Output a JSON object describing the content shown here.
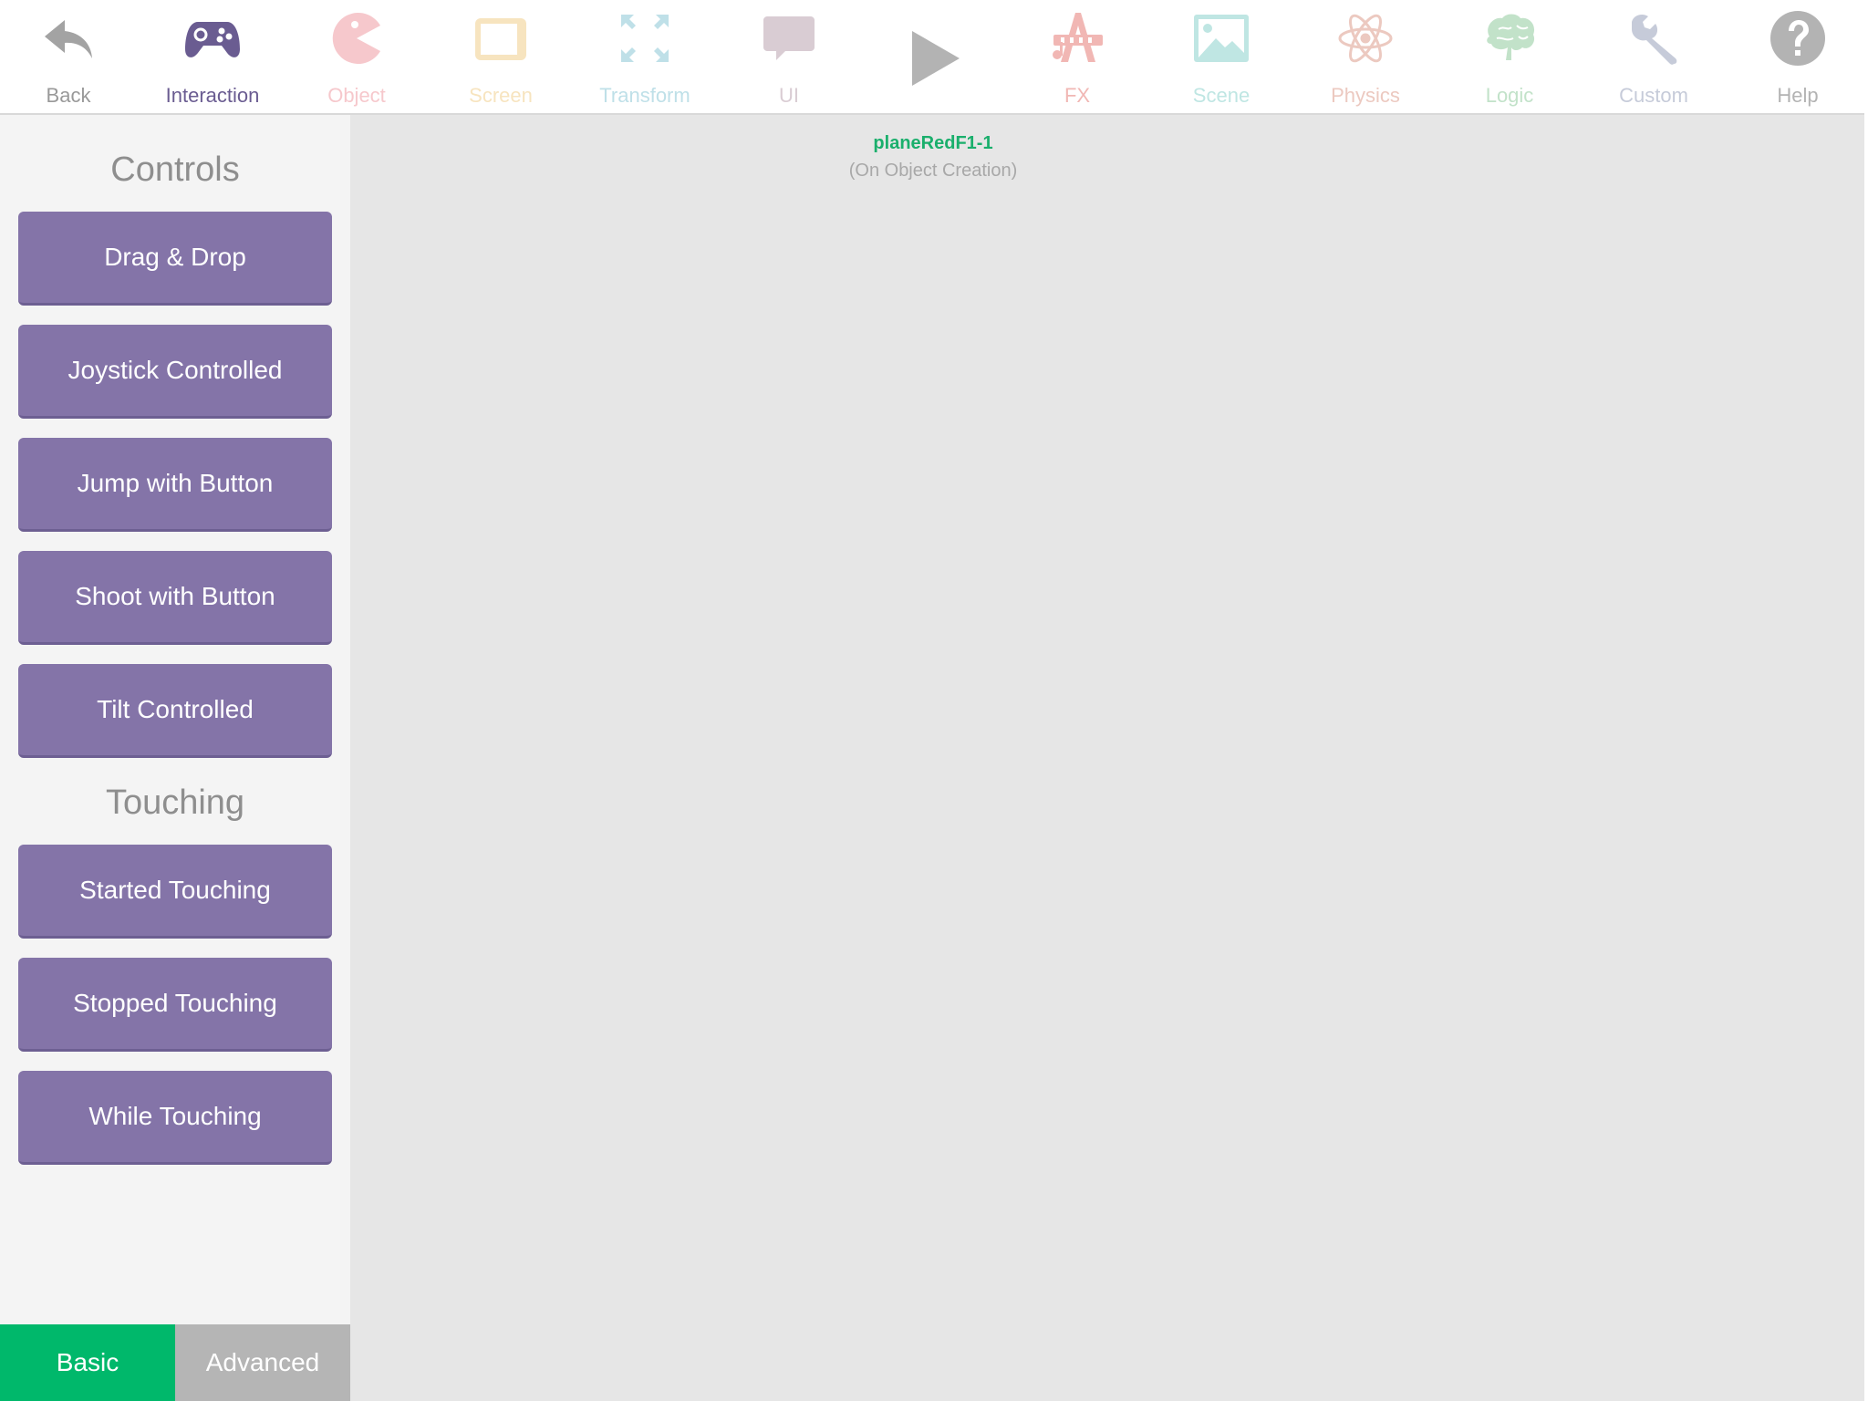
{
  "toolbar": {
    "back": {
      "label": "Back",
      "color": "#999999",
      "icon": "back-arrow-icon"
    },
    "interaction": {
      "label": "Interaction",
      "color": "#6a5c91",
      "icon": "gamepad-icon"
    },
    "object": {
      "label": "Object",
      "color": "#f6c8cc",
      "icon": "pacman-icon"
    },
    "screen": {
      "label": "Screen",
      "color": "#f7e4bf",
      "icon": "tablet-screen-icon"
    },
    "transform": {
      "label": "Transform",
      "color": "#bfe0e8",
      "icon": "transform-arrows-icon"
    },
    "ui": {
      "label": "UI",
      "color": "#d9ccd3",
      "icon": "speech-bubble-icon"
    },
    "play": {
      "icon": "play-icon",
      "color": "#b3b3b3"
    },
    "fx": {
      "label": "FX",
      "color": "#f1b7b4",
      "icon": "fx-music-icon"
    },
    "scene": {
      "label": "Scene",
      "color": "#bfe6e3",
      "icon": "scene-image-icon"
    },
    "physics": {
      "label": "Physics",
      "color": "#ecc9c0",
      "icon": "atom-icon"
    },
    "logic": {
      "label": "Logic",
      "color": "#c2e2c9",
      "icon": "brain-icon"
    },
    "custom": {
      "label": "Custom",
      "color": "#c6cbd9",
      "icon": "wrench-icon"
    },
    "help": {
      "label": "Help",
      "color": "#b3b3b3",
      "icon": "question-icon"
    }
  },
  "sidebar": {
    "controls_title": "Controls",
    "controls": [
      {
        "label": "Drag & Drop"
      },
      {
        "label": "Joystick Controlled"
      },
      {
        "label": "Jump with Button"
      },
      {
        "label": "Shoot with Button"
      },
      {
        "label": "Tilt Controlled"
      }
    ],
    "touching_title": "Touching",
    "touching": [
      {
        "label": "Started Touching"
      },
      {
        "label": "Stopped Touching"
      },
      {
        "label": "While Touching"
      }
    ],
    "tabs": {
      "basic": "Basic",
      "advanced": "Advanced"
    },
    "button_color": "#8474a8",
    "active_tab_color": "#00b86b"
  },
  "canvas": {
    "object_name": "planeRedF1-1",
    "event_name": "(On Object Creation)"
  }
}
